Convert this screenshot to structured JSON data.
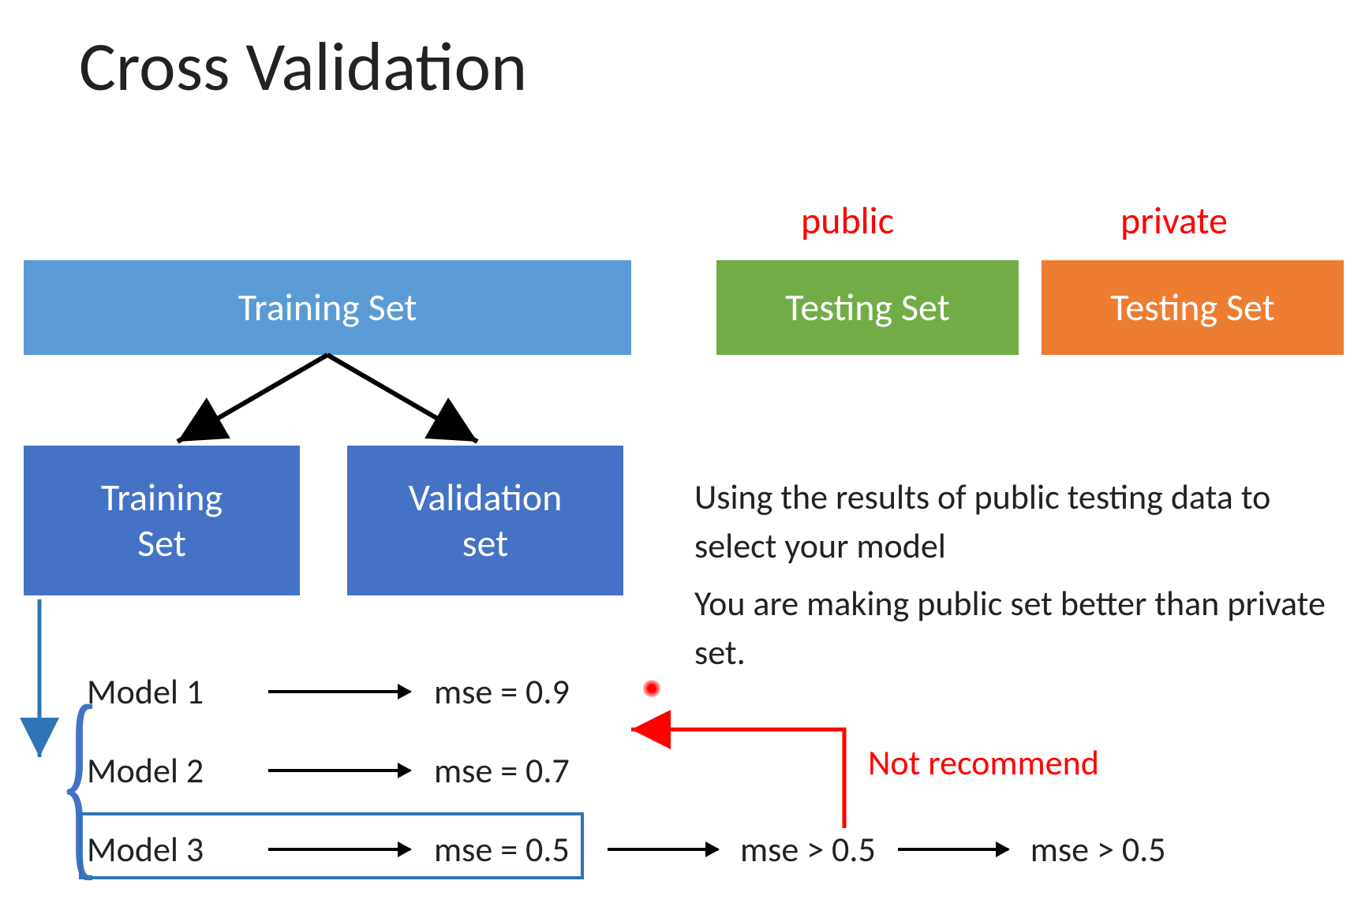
{
  "title": "Cross Validation",
  "boxes": {
    "training_main": "Training Set",
    "training_sub": "Training\nSet",
    "validation": "Validation\nset",
    "testing_public": "Testing Set",
    "testing_private": "Testing Set"
  },
  "labels": {
    "public": "public",
    "private": "private",
    "not_recommend": "Not recommend"
  },
  "paragraph": {
    "line1": "Using the results of public testing data to select your model",
    "line2": "You are making public set better than private set."
  },
  "models": [
    {
      "name": "Model 1",
      "mse": "mse = 0.9"
    },
    {
      "name": "Model 2",
      "mse": "mse = 0.7"
    },
    {
      "name": "Model 3",
      "mse": "mse = 0.5"
    }
  ],
  "chain": {
    "mse1": "mse > 0.5",
    "mse2": "mse > 0.5"
  },
  "colors": {
    "training_main": "#5b9bd5",
    "training_sub": "#4472c4",
    "testing_public": "#70ad47",
    "testing_private": "#ed7d31",
    "red": "#ff0000",
    "highlight": "#2e75b6"
  }
}
